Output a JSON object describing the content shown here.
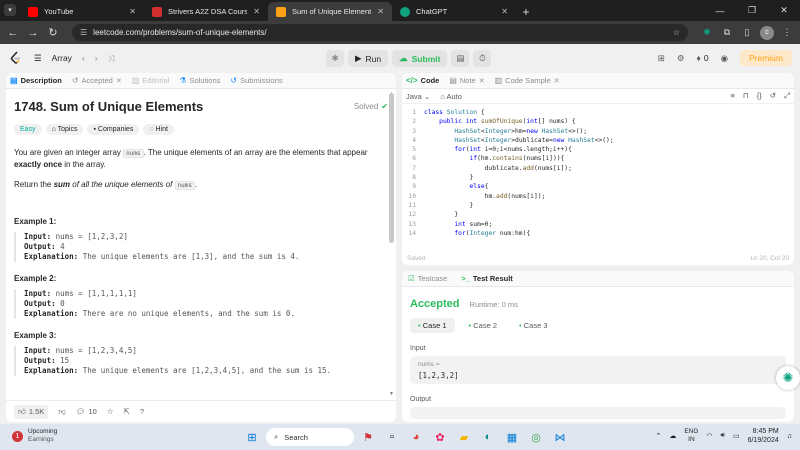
{
  "browser": {
    "tabs": [
      {
        "title": "YouTube",
        "color": "#ff0000",
        "active": false
      },
      {
        "title": "Strivers A2Z DSA Course/Sheet",
        "color": "#d32f2f",
        "active": false
      },
      {
        "title": "Sum of Unique Elements - Leet",
        "color": "#ffa116",
        "active": true
      },
      {
        "title": "ChatGPT",
        "color": "#10a37f",
        "active": false
      }
    ],
    "url": "leetcode.com/problems/sum-of-unique-elements/",
    "profile_initial": "c"
  },
  "lc_header": {
    "list_label": "Array",
    "run_label": "Run",
    "submit_label": "Submit",
    "coins": "0",
    "premium_label": "Premium"
  },
  "left_tabs": {
    "description": "Description",
    "accepted": "Accepted",
    "editorial": "Editorial",
    "solutions": "Solutions",
    "submissions": "Submissions"
  },
  "problem": {
    "title": "1748. Sum of Unique Elements",
    "status": "Solved",
    "difficulty": "Easy",
    "tags": [
      "Topics",
      "Companies",
      "Hint"
    ],
    "desc_p1_a": "You are given an integer array ",
    "desc_p1_code": "nums",
    "desc_p1_b": ". The unique elements of an array are the elements that appear ",
    "desc_p1_bold": "exactly once",
    "desc_p1_c": " in the array.",
    "desc_p2_a": "Return the ",
    "desc_p2_bold": "sum",
    "desc_p2_b": " of all the unique elements of ",
    "desc_p2_code": "nums",
    "desc_p2_c": ".",
    "examples": [
      {
        "title": "Example 1:",
        "input": "nums = [1,2,3,2]",
        "output": "4",
        "explanation": "The unique elements are [1,3], and the sum is 4."
      },
      {
        "title": "Example 2:",
        "input": "nums = [1,1,1,1,1]",
        "output": "0",
        "explanation": "There are no unique elements, and the sum is 0."
      },
      {
        "title": "Example 3:",
        "input": "nums = [1,2,3,4,5]",
        "output": "15",
        "explanation": "The unique elements are [1,2,3,4,5], and the sum is 15."
      }
    ],
    "input_label": "Input:",
    "output_label": "Output:",
    "explanation_label": "Explanation:",
    "likes": "1.5K",
    "comments": "10"
  },
  "code_panel": {
    "tab_code": "Code",
    "tab_note": "Note",
    "tab_sample": "Code Sample",
    "language": "Java",
    "auto": "Auto",
    "saved": "Saved",
    "cursor": "Ln 20, Col 20",
    "lines": [
      "class Solution {",
      "    public int sumOfUnique(int[] nums) {",
      "        HashSet<Integer>hm=new HashSet<>();",
      "        HashSet<Integer>dublicate=new HashSet<>();",
      "        for(int i=0;i<nums.length;i++){",
      "            if(hm.contains(nums[i])){",
      "                dublicate.add(nums[i]);",
      "            }",
      "            else{",
      "                hm.add(nums[i]);",
      "            }",
      "        }",
      "        int sum=0;",
      "        for(Integer num:hm){"
    ]
  },
  "result_panel": {
    "tab_testcase": "Testcase",
    "tab_result": "Test Result",
    "verdict": "Accepted",
    "runtime": "Runtime: 0 ms",
    "cases": [
      "Case 1",
      "Case 2",
      "Case 3"
    ],
    "input_label": "Input",
    "var_name": "nums =",
    "var_value": "[1,2,3,2]",
    "output_label": "Output"
  },
  "taskbar": {
    "weather_badge": "1",
    "weather_title": "Upcoming",
    "weather_sub": "Earnings",
    "search": "Search",
    "lang1": "ENG",
    "lang2": "IN",
    "time": "8:45 PM",
    "date": "6/19/2024"
  }
}
